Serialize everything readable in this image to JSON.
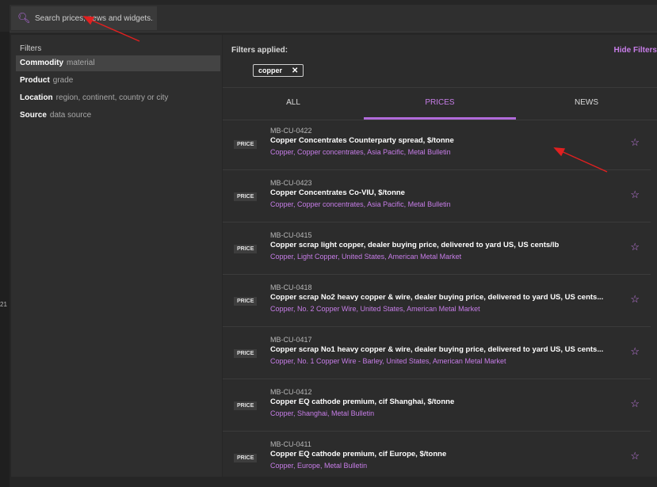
{
  "search": {
    "placeholder": "Search prices, news and widgets..."
  },
  "filters_panel": {
    "title": "Filters",
    "items": [
      {
        "strong": "Commodity",
        "muted": "material",
        "active": true
      },
      {
        "strong": "Product",
        "muted": "grade",
        "active": false
      },
      {
        "strong": "Location",
        "muted": "region, continent, country or city",
        "active": false
      },
      {
        "strong": "Source",
        "muted": "data source",
        "active": false
      }
    ]
  },
  "applied": {
    "label": "Filters applied:",
    "hide_label": "Hide Filters",
    "chips": [
      {
        "text": "copper",
        "remove": "✕"
      }
    ]
  },
  "tabs": [
    {
      "label": "ALL",
      "active": false
    },
    {
      "label": "PRICES",
      "active": true
    },
    {
      "label": "NEWS",
      "active": false
    }
  ],
  "results": [
    {
      "badge": "PRICE",
      "code": "MB-CU-0422",
      "title": "Copper Concentrates Counterparty spread, $/tonne",
      "tags": "Copper, Copper concentrates, Asia Pacific, Metal Bulletin"
    },
    {
      "badge": "PRICE",
      "code": "MB-CU-0423",
      "title": "Copper Concentrates Co-VIU, $/tonne",
      "tags": "Copper, Copper concentrates, Asia Pacific, Metal Bulletin"
    },
    {
      "badge": "PRICE",
      "code": "MB-CU-0415",
      "title": "Copper scrap light copper, dealer buying price, delivered to yard US, US cents/lb",
      "tags": "Copper, Light Copper, United States, American Metal Market"
    },
    {
      "badge": "PRICE",
      "code": "MB-CU-0418",
      "title": "Copper scrap No2 heavy copper & wire, dealer buying price, delivered to yard US, US cents...",
      "tags": "Copper, No. 2 Copper Wire, United States, American Metal Market"
    },
    {
      "badge": "PRICE",
      "code": "MB-CU-0417",
      "title": "Copper scrap No1 heavy copper & wire, dealer buying price, delivered to yard US, US cents...",
      "tags": "Copper, No. 1 Copper Wire - Barley, United States, American Metal Market"
    },
    {
      "badge": "PRICE",
      "code": "MB-CU-0412",
      "title": "Copper EQ cathode premium, cif Shanghai, $/tonne",
      "tags": "Copper, Shanghai, Metal Bulletin"
    },
    {
      "badge": "PRICE",
      "code": "MB-CU-0411",
      "title": "Copper EQ cathode premium, cif Europe, $/tonne",
      "tags": "Copper, Europe, Metal Bulletin"
    }
  ],
  "left_strip": {
    "marks": [
      "21"
    ]
  },
  "colors": {
    "accent": "#c77de8",
    "annotation_arrow": "#e02020"
  }
}
